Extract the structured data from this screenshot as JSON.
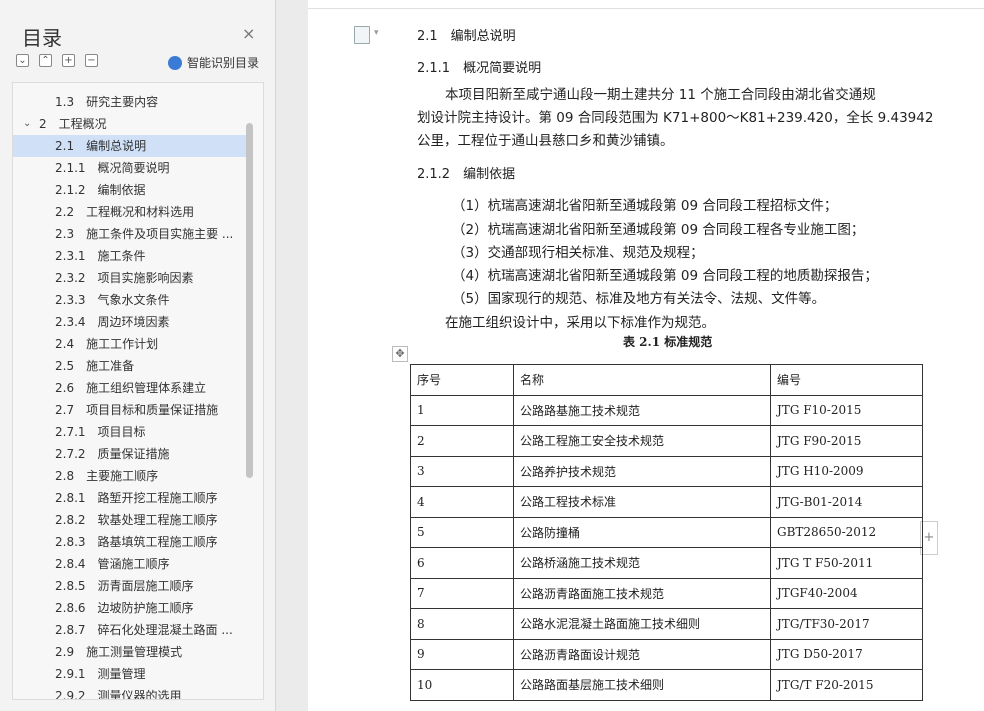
{
  "sidebar": {
    "title": "目录",
    "close_glyph": "×",
    "tool_buttons": [
      "⌄",
      "⌃",
      "+",
      "−"
    ],
    "smart_label": "智能识别目录",
    "items": [
      {
        "text": "1.3　研究主要内容",
        "level": 1,
        "active": false,
        "expanded": false
      },
      {
        "text": "2　工程概况",
        "level": 0,
        "active": false,
        "expanded": true
      },
      {
        "text": "2.1　编制总说明",
        "level": 1,
        "active": true,
        "expanded": false
      },
      {
        "text": "2.1.1　概况简要说明",
        "level": 1,
        "active": false,
        "expanded": false
      },
      {
        "text": "2.1.2　编制依据",
        "level": 1,
        "active": false,
        "expanded": false
      },
      {
        "text": "2.2　工程概况和材料选用",
        "level": 1,
        "active": false,
        "expanded": false
      },
      {
        "text": "2.3　施工条件及项目实施主要 ...",
        "level": 1,
        "active": false,
        "expanded": false
      },
      {
        "text": "2.3.1　施工条件",
        "level": 1,
        "active": false,
        "expanded": false
      },
      {
        "text": "2.3.2　项目实施影响因素",
        "level": 1,
        "active": false,
        "expanded": false
      },
      {
        "text": "2.3.3　气象水文条件",
        "level": 1,
        "active": false,
        "expanded": false
      },
      {
        "text": "2.3.4　周边环境因素",
        "level": 1,
        "active": false,
        "expanded": false
      },
      {
        "text": "2.4　施工工作计划",
        "level": 1,
        "active": false,
        "expanded": false
      },
      {
        "text": "2.5　施工准备",
        "level": 1,
        "active": false,
        "expanded": false
      },
      {
        "text": "2.6　施工组织管理体系建立",
        "level": 1,
        "active": false,
        "expanded": false
      },
      {
        "text": "2.7　项目目标和质量保证措施",
        "level": 1,
        "active": false,
        "expanded": false
      },
      {
        "text": "2.7.1　项目目标",
        "level": 1,
        "active": false,
        "expanded": false
      },
      {
        "text": "2.7.2　质量保证措施",
        "level": 1,
        "active": false,
        "expanded": false
      },
      {
        "text": "2.8　主要施工顺序",
        "level": 1,
        "active": false,
        "expanded": false
      },
      {
        "text": "2.8.1　路堑开挖工程施工顺序",
        "level": 1,
        "active": false,
        "expanded": false
      },
      {
        "text": "2.8.2　软基处理工程施工顺序",
        "level": 1,
        "active": false,
        "expanded": false
      },
      {
        "text": "2.8.3　路基填筑工程施工顺序",
        "level": 1,
        "active": false,
        "expanded": false
      },
      {
        "text": "2.8.4　管涵施工顺序",
        "level": 1,
        "active": false,
        "expanded": false
      },
      {
        "text": "2.8.5　沥青面层施工顺序",
        "level": 1,
        "active": false,
        "expanded": false
      },
      {
        "text": "2.8.6　边坡防护施工顺序",
        "level": 1,
        "active": false,
        "expanded": false
      },
      {
        "text": "2.8.7　碎石化处理混凝土路面 ...",
        "level": 1,
        "active": false,
        "expanded": false
      },
      {
        "text": "2.9　施工测量管理模式",
        "level": 1,
        "active": false,
        "expanded": false
      },
      {
        "text": "2.9.1　测量管理",
        "level": 1,
        "active": false,
        "expanded": false
      },
      {
        "text": "2.9.2　测量仪器的选用",
        "level": 1,
        "active": false,
        "expanded": false
      }
    ]
  },
  "document": {
    "h1": "2.1　编制总说明",
    "h2a": "2.1.1　概况简要说明",
    "para1_line1": "本项目阳新至咸宁通山段一期土建共分 11 个施工合同段由湖北省交通规",
    "para1_line2": "划设计院主持设计。第 09 合同段范围为 K71+800～K81+239.420，全长 9.43942",
    "para1_line3": "公里，工程位于通山县慈口乡和黄沙铺镇。",
    "h2b": "2.1.2　编制依据",
    "list": [
      "（1）杭瑞高速湖北省阳新至通城段第 09 合同段工程招标文件；",
      "（2）杭瑞高速湖北省阳新至通城段第 09 合同段工程各专业施工图；",
      "（3）交通部现行相关标准、规范及规程；",
      "（4）杭瑞高速湖北省阳新至通城段第 09 合同段工程的地质勘探报告；",
      "（5）国家现行的规范、标准及地方有关法令、法规、文件等。"
    ],
    "para2": "在施工组织设计中，采用以下标准作为规范。",
    "caption": "表 2.1  标准规范",
    "table": {
      "headers": [
        "序号",
        "名称",
        "编号"
      ],
      "rows": [
        [
          "1",
          "公路路基施工技术规范",
          "JTG F10-2015"
        ],
        [
          "2",
          "公路工程施工安全技术规范",
          "JTG F90-2015"
        ],
        [
          "3",
          "公路养护技术规范",
          "JTG H10-2009"
        ],
        [
          "4",
          "公路工程技术标准",
          "JTG-B01-2014"
        ],
        [
          "5",
          "公路防撞桶",
          "GBT28650-2012"
        ],
        [
          "6",
          "公路桥涵施工技术规范",
          "JTG T F50-2011"
        ],
        [
          "7",
          "公路沥青路面施工技术规范",
          "JTGF40-2004"
        ],
        [
          "8",
          "公路水泥混凝土路面施工技术细则",
          "JTG/TF30-2017"
        ],
        [
          "9",
          "公路沥青路面设计规范",
          "JTG D50-2017"
        ],
        [
          "10",
          "公路路面基层施工技术细则",
          "JTG/T F20-2015"
        ]
      ]
    },
    "move_glyph": "✥",
    "add_glyph": "+"
  }
}
